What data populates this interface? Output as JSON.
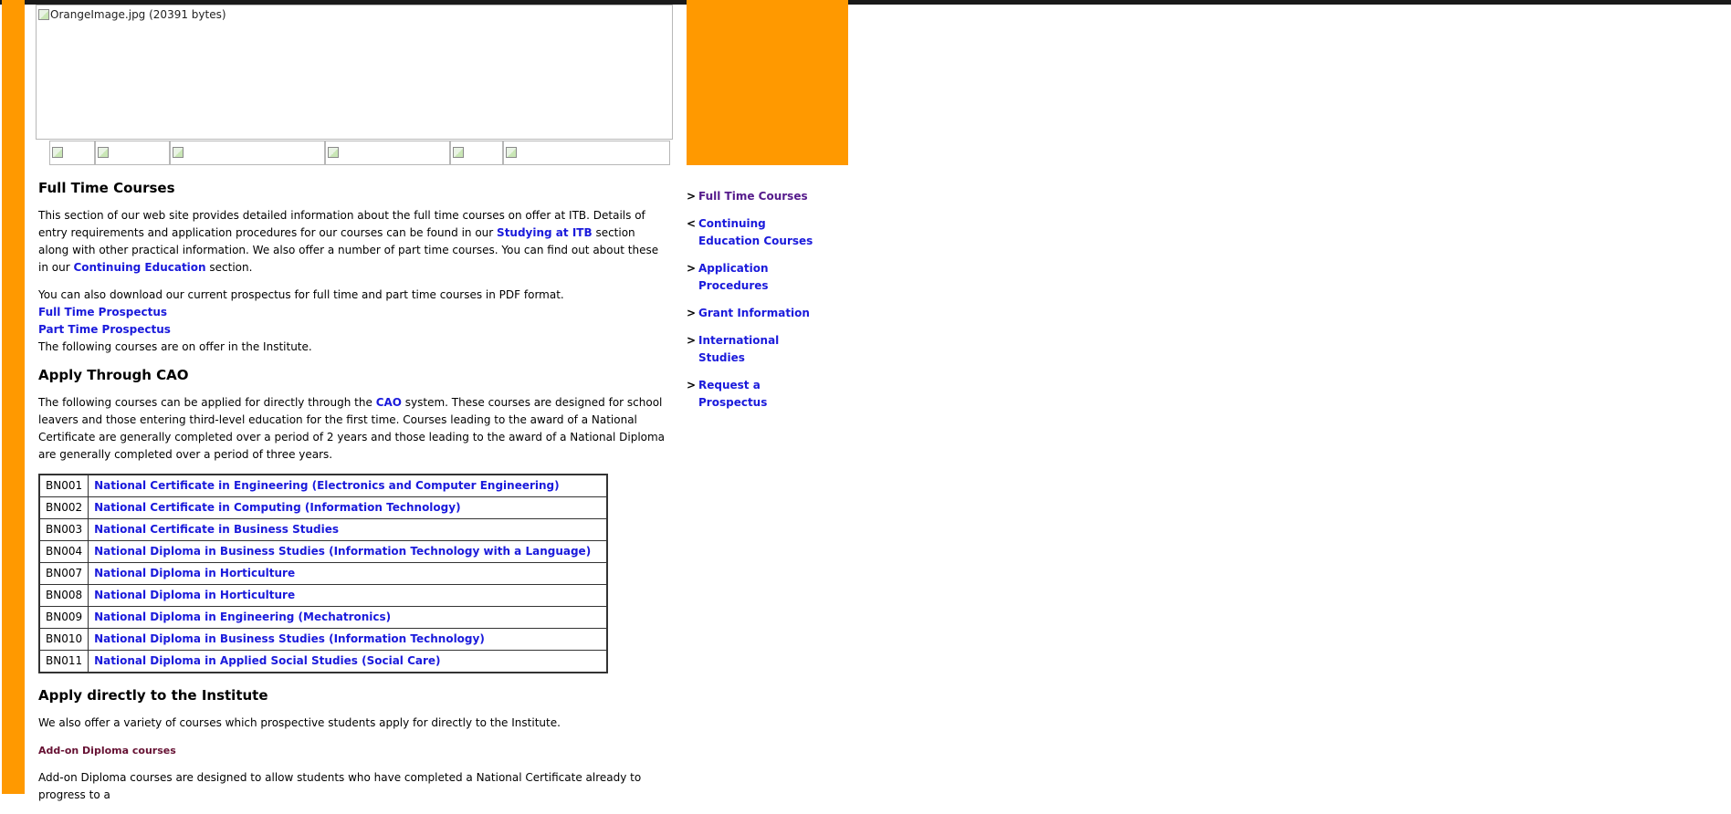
{
  "header": {
    "hero_image_alt": "OrangeImage.jpg (20391 bytes)"
  },
  "main": {
    "section1": {
      "heading": "Full Time Courses",
      "p1_before": "This section of our web site provides detailed information about the full time courses on offer at ITB. Details of entry requirements and application procedures for our courses can be found in our ",
      "p1_link1": "Studying at ITB",
      "p1_mid": " section along with other practical information. We also offer a number of part time courses. You can find out about these in our ",
      "p1_link2": "Continuing Education",
      "p1_after": " section.",
      "p2": "You can also download our current prospectus for full time and part time courses in PDF format.",
      "link_full_prospectus": "Full Time Prospectus",
      "link_part_prospectus": "Part Time Prospectus",
      "p3": "The following courses are on offer in the Institute."
    },
    "section2": {
      "heading": "Apply Through CAO",
      "p_before": "The following courses can be applied for directly through the ",
      "p_link": "CAO",
      "p_after": " system. These courses are designed for school leavers and those entering third-level education for the first time. Courses leading to the award of a National Certificate are generally completed over a period of 2 years and those leading to the award of a National Diploma are generally completed over a period of three years.",
      "courses": [
        {
          "code": "BN001",
          "title": "National Certificate in Engineering (Electronics and Computer Engineering)"
        },
        {
          "code": "BN002",
          "title": "National Certificate in Computing (Information Technology)"
        },
        {
          "code": "BN003",
          "title": "National Certificate in Business Studies"
        },
        {
          "code": "BN004",
          "title": "National Diploma in Business Studies (Information Technology with a Language)"
        },
        {
          "code": "BN007",
          "title": "National Diploma in Horticulture"
        },
        {
          "code": "BN008",
          "title": "National Diploma in Horticulture"
        },
        {
          "code": "BN009",
          "title": "National Diploma in Engineering (Mechatronics)"
        },
        {
          "code": "BN010",
          "title": "National Diploma in Business Studies (Information Technology)"
        },
        {
          "code": "BN011",
          "title": "National Diploma in Applied Social Studies (Social Care)"
        }
      ]
    },
    "section3": {
      "heading": "Apply directly to the Institute",
      "p1": "We also offer a variety of courses which prospective students apply for directly to the Institute.",
      "subheading": "Add-on Diploma courses",
      "p2": "Add-on Diploma courses are designed to allow students who have completed a National Certificate already to progress to a"
    }
  },
  "sidebar": {
    "items": [
      {
        "arrow": ">",
        "label": "Full Time Courses"
      },
      {
        "arrow": "<",
        "label": "Continuing Education Courses"
      },
      {
        "arrow": ">",
        "label": "Application Procedures"
      },
      {
        "arrow": ">",
        "label": "Grant Information"
      },
      {
        "arrow": ">",
        "label": "International Studies"
      },
      {
        "arrow": ">",
        "label": "Request a Prospectus"
      }
    ]
  },
  "colors": {
    "accent_orange": "#ff9900",
    "link_blue": "#1a1adb",
    "visited_purple": "#551a8b",
    "subheading_maroon": "#661133"
  }
}
